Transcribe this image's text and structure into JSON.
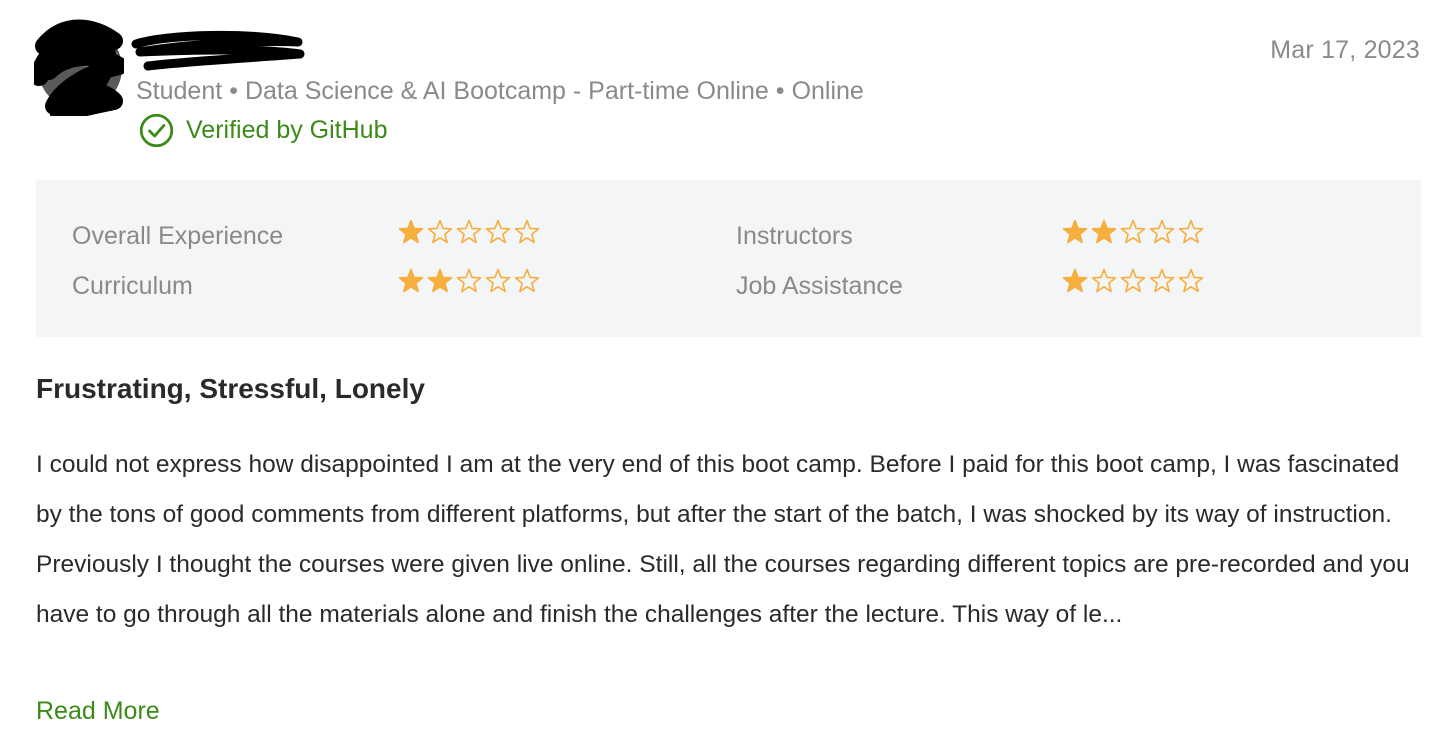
{
  "review": {
    "date": "Mar 17, 2023",
    "reviewer": {
      "role": "Student",
      "program": "Data Science & AI Bootcamp - Part-time Online",
      "location": "Online",
      "separator": "•",
      "verified_text": "Verified by GitHub"
    },
    "ratings": [
      {
        "label": "Overall Experience",
        "stars": 1,
        "max": 5
      },
      {
        "label": "Curriculum",
        "stars": 2,
        "max": 5
      },
      {
        "label": "Instructors",
        "stars": 2,
        "max": 5
      },
      {
        "label": "Job Assistance",
        "stars": 1,
        "max": 5
      }
    ],
    "title": "Frustrating, Stressful, Lonely",
    "body": "I could not express how disappointed I am at the very end of this boot camp. Before I paid for this boot camp, I was fascinated by the tons of good comments from different platforms, but after the start of the batch, I was shocked by its way of instruction. Previously I thought the courses were given live online. Still, all the courses regarding different topics are pre-recorded and you have to go through all the materials alone and finish the challenges after the lecture. This way of le...",
    "read_more_label": "Read More"
  },
  "colors": {
    "star": "#f6ae3c",
    "verified": "#3c8a17",
    "muted_text": "#8a8a8a",
    "panel_bg": "#f4f5f7"
  }
}
